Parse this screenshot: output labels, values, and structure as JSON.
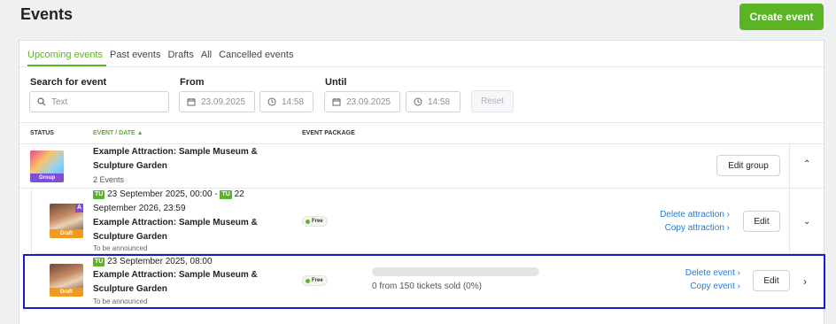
{
  "header": {
    "title": "Events",
    "create_label": "Create event"
  },
  "tabs": [
    {
      "label": "Upcoming events",
      "active": true
    },
    {
      "label": "Past events",
      "active": false
    },
    {
      "label": "Drafts",
      "active": false
    },
    {
      "label": "All",
      "active": false
    },
    {
      "label": "Cancelled events",
      "active": false
    }
  ],
  "filters": {
    "search_label": "Search for event",
    "search_placeholder": "Text",
    "from_label": "From",
    "from_date": "23.09.2025",
    "from_time": "14:58",
    "until_label": "Until",
    "until_date": "23.09.2025",
    "until_time": "14:58",
    "reset_label": "Reset"
  },
  "columns": {
    "status": "STATUS",
    "event_date": "EVENT / DATE",
    "package": "EVENT PACKAGE"
  },
  "rows": [
    {
      "badge": "Group",
      "badge_color": "#7b4fd6",
      "name_line1": "Example Attraction: Sample Museum &",
      "name_line2": "Sculpture Garden",
      "sub": "2 Events",
      "edit_label": "Edit group",
      "chevron": "up-chevron"
    },
    {
      "badge": "Draft",
      "badge_color": "#f39a1e",
      "corner_letter": "A",
      "day_tag": "TU",
      "date_line1": "23 September 2025, 00:00 -",
      "day_tag2": "TU",
      "date_line1b": "22",
      "date_line2": "September 2026, 23:59",
      "name_line1": "Example Attraction: Sample Museum &",
      "name_line2": "Sculpture Garden",
      "sub": "To be announced",
      "package": "Free",
      "link1": "Delete attraction",
      "link2": "Copy attraction",
      "edit_label": "Edit",
      "chevron": "down-chevron"
    },
    {
      "badge": "Draft",
      "badge_color": "#f39a1e",
      "day_tag": "TU",
      "date_line1": "23 September 2025, 08:00",
      "name_line1": "Example Attraction: Sample Museum &",
      "name_line2": "Sculpture Garden",
      "sub": "To be announced",
      "package": "Free",
      "tickets": "0 from 150 tickets sold (0%)",
      "tickets_sold_fraction": 0,
      "link1": "Delete event",
      "link2": "Copy event",
      "edit_label": "Edit",
      "chevron": "right-chevron"
    }
  ],
  "colors": {
    "accent": "#5bb424",
    "link": "#1f7bd6",
    "highlight": "#1a1acc"
  }
}
